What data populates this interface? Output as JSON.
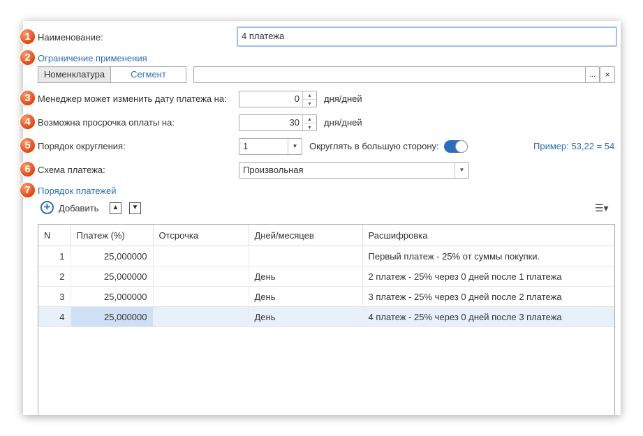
{
  "form": {
    "name_label": "Наименование:",
    "name_value": "4 платежа",
    "restriction_label": "Ограничение применения",
    "segments": [
      "Номенклатура",
      "Сегмент"
    ],
    "restriction_value": "",
    "select_dots": "...",
    "clear_x": "×",
    "manager_label": "Менеджер может изменить дату платежа на:",
    "manager_value": "0",
    "manager_unit": "дня/дней",
    "overdue_label": "Возможна просрочка оплаты на:",
    "overdue_value": "30",
    "overdue_unit": "дня/дней",
    "rounding_label": "Порядок округления:",
    "rounding_value": "1",
    "round_up_label": "Округлять в большую сторону:",
    "round_up_on": true,
    "example_text": "Пример: 53,22 = 54",
    "scheme_label": "Схема платежа:",
    "scheme_value": "Произвольная",
    "payments_label": "Порядок платежей"
  },
  "badges": [
    "1",
    "2",
    "3",
    "4",
    "5",
    "6",
    "7"
  ],
  "toolbar": {
    "add_label": "Добавить",
    "up_glyph": "▲",
    "down_glyph": "▼",
    "menu_glyph": "☰▾"
  },
  "table": {
    "columns": [
      "N",
      "Платеж (%)",
      "Отсрочка",
      "Дней/месяцев",
      "Расшифровка"
    ],
    "rows": [
      {
        "n": "1",
        "percent": "25,000000",
        "delay": "",
        "unit": "",
        "desc": "Первый платеж - 25% от суммы покупки."
      },
      {
        "n": "2",
        "percent": "25,000000",
        "delay": "",
        "unit": "День",
        "desc": "2 платеж - 25% через 0 дней после 1 платежа"
      },
      {
        "n": "3",
        "percent": "25,000000",
        "delay": "",
        "unit": "День",
        "desc": "3 платеж - 25% через 0 дней после 2 платежа"
      },
      {
        "n": "4",
        "percent": "25,000000",
        "delay": "",
        "unit": "День",
        "desc": "4 платеж - 25% через 0 дней после 3 платежа"
      }
    ],
    "selected_row": 4
  },
  "colors": {
    "accent": "#2a6ebf",
    "link": "#2d6db4",
    "badge": "#e2460f",
    "selection": "#e8f0fa"
  }
}
